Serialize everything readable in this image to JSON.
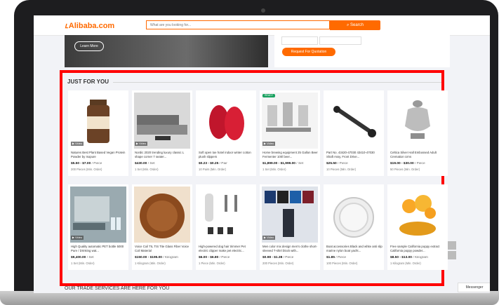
{
  "header": {
    "logo": "Alibaba.com",
    "search_placeholder": "What are you looking for...",
    "search_button": "Search"
  },
  "hero": {
    "learn_more": "Learn More",
    "rfq_button": "Request For Quotation"
  },
  "section": {
    "title": "JUST FOR YOU",
    "footer_title": "OUR TRADE SERVICES ARE HERE FOR YOU"
  },
  "video_label": "Video",
  "messenger": "Messenger",
  "products": [
    {
      "title": "Natures Best Plant Based Vegan Protein Powder by Isopure",
      "price": "$5.50 - $7.00",
      "unit": "/ Piece",
      "moq": "200 Pieces (Min. Order)",
      "video": true,
      "badge": "",
      "icon": "protein-jar-icon"
    },
    {
      "title": "Nordic 2020 trending luxury classic L shape corner 7 seater...",
      "price": "$430.00",
      "unit": "/ Set",
      "moq": "1 Set (Min. Order)",
      "video": true,
      "badge": "",
      "icon": "sofa-icon"
    },
    {
      "title": "Soft open toe hotel indoor winter cotton plush slippers",
      "price": "$0.23 - $0.25",
      "unit": "/ Pair",
      "moq": "10 Pairs (Min. Order)",
      "video": false,
      "badge": "",
      "icon": "slippers-icon"
    },
    {
      "title": "Home brewing equipment 25 Gallon Beer Fermenter 100l beer...",
      "price": "$1,899.00 - $1,999.00",
      "unit": "/ Set",
      "moq": "1 Set (Min. Order)",
      "video": true,
      "badge": "READY",
      "icon": "brewing-equipment-icon"
    },
    {
      "title": "Part No. 43420-47030 43410-47030 Shaft Assy, Front Drive...",
      "price": "$25.50",
      "unit": "/ Piece",
      "moq": "10 Pieces (Min. Order)",
      "video": false,
      "badge": "",
      "icon": "drive-shaft-icon"
    },
    {
      "title": "Celtica Silver Hall Embossed Adult Cremation Urns",
      "price": "$19.00 - $30.00",
      "unit": "/ Piece",
      "moq": "50 Pieces (Min. Order)",
      "video": false,
      "badge": "",
      "icon": "urn-icon"
    },
    {
      "title": "High Quality automatic PET bottle 5000 Pure / Drinking wat...",
      "price": "$9,400.00",
      "unit": "/ Set",
      "moq": "1 Set (Min. Order)",
      "video": true,
      "badge": "",
      "icon": "bottling-line-icon"
    },
    {
      "title": "Voice Coil TIL TIS Tite Glass Fiber Voice Coil Material",
      "price": "$150.00 - $195.00",
      "unit": "/ Kilogram",
      "moq": "1 Kilogram (Min. Order)",
      "video": false,
      "badge": "",
      "icon": "voice-coil-icon"
    },
    {
      "title": "High-powered dog hair trimmer Pet electric clipper make pet electric...",
      "price": "$6.00 - $6.80",
      "unit": "/ Piece",
      "moq": "1 Piece (Min. Order)",
      "video": false,
      "badge": "",
      "icon": "pet-clipper-icon"
    },
    {
      "title": "Men color mix design men's clothe short-sleeved T-shirt block with...",
      "price": "$0.98 - $1.38",
      "unit": "/ Piece",
      "moq": "200 Pieces (Min. Order)",
      "video": true,
      "badge": "",
      "icon": "tshirts-icon"
    },
    {
      "title": "Boat accessories Black and white anti slip marine nylon boat yacht...",
      "price": "$1.85",
      "unit": "/ Piece",
      "moq": "100 Pieces (Min. Order)",
      "video": false,
      "badge": "",
      "icon": "deck-plate-icon"
    },
    {
      "title": "Free sample California poppy extract California poppy powder...",
      "price": "$8.50 - $13.00",
      "unit": "/ Kilogram",
      "moq": "1 Kilogram (Min. Order)",
      "video": false,
      "badge": "",
      "icon": "poppy-powder-icon"
    }
  ]
}
